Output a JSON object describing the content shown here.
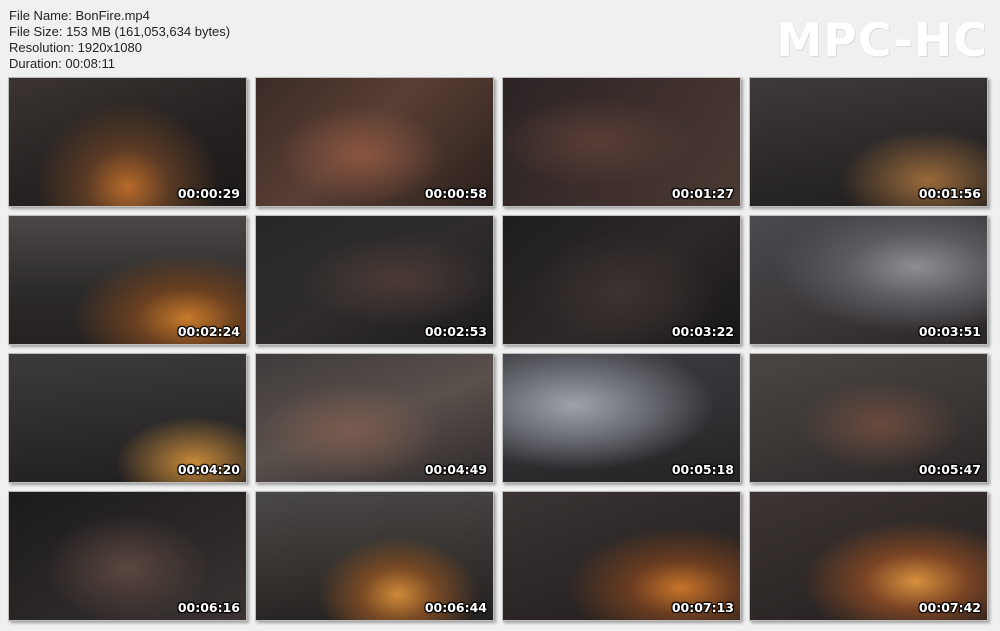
{
  "header": {
    "file_name": "File Name: BonFire.mp4",
    "file_size": "File Size: 153 MB (161,053,634 bytes)",
    "resolution": "Resolution: 1920x1080",
    "duration": "Duration: 00:08:11"
  },
  "logo": "MPC-HC",
  "thumbnails": [
    {
      "timestamp": "00:00:29",
      "scene": "fire-a"
    },
    {
      "timestamp": "00:00:58",
      "scene": "warm-a"
    },
    {
      "timestamp": "00:01:27",
      "scene": "warm-b"
    },
    {
      "timestamp": "00:01:56",
      "scene": "night-a"
    },
    {
      "timestamp": "00:02:24",
      "scene": "fire-b"
    },
    {
      "timestamp": "00:02:53",
      "scene": "dark-a"
    },
    {
      "timestamp": "00:03:22",
      "scene": "dark-b"
    },
    {
      "timestamp": "00:03:51",
      "scene": "smoke-a"
    },
    {
      "timestamp": "00:04:20",
      "scene": "night-b"
    },
    {
      "timestamp": "00:04:49",
      "scene": "ground-a"
    },
    {
      "timestamp": "00:05:18",
      "scene": "smoke-b"
    },
    {
      "timestamp": "00:05:47",
      "scene": "ground-b"
    },
    {
      "timestamp": "00:06:16",
      "scene": "dark-c"
    },
    {
      "timestamp": "00:06:44",
      "scene": "fire-c"
    },
    {
      "timestamp": "00:07:13",
      "scene": "fire-d"
    },
    {
      "timestamp": "00:07:42",
      "scene": "fire-e"
    }
  ]
}
